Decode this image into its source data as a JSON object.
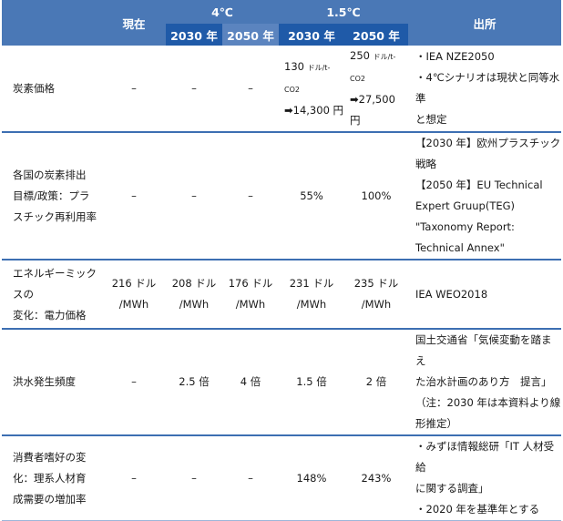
{
  "header": {
    "current": "現在",
    "group_4c": "4℃",
    "group_15c": "1.5℃",
    "source": "出所",
    "y2030": "2030 年",
    "y2050": "2050 年"
  },
  "rows": [
    {
      "label": [
        "炭素価格"
      ],
      "current": "–",
      "c4_2030": "–",
      "c4_2050": "–",
      "c15_2030": {
        "price": "130",
        "unit": "ドル/t-CO2",
        "yen": "14,300 円"
      },
      "c15_2050": {
        "price": "250",
        "unit": "ドル/t-CO2",
        "yen": "27,500 円"
      },
      "source": [
        "・IEA NZE2050",
        "・4℃シナリオは現状と同等水準",
        "と想定"
      ]
    },
    {
      "label": [
        "各国の炭素排出",
        "目標/政策：プラ",
        "スチック再利用率"
      ],
      "current": "–",
      "c4_2030": "–",
      "c4_2050": "–",
      "c15_2030": "55%",
      "c15_2050": "100%",
      "source": [
        "【2030 年】欧州プラスチック戦略",
        "【2050 年】EU Technical",
        "Expert Gruup(TEG)",
        "\"Taxonomy Report:",
        "Technical Annex\""
      ]
    },
    {
      "label": [
        "エネルギーミックスの",
        "変化：電力価格"
      ],
      "current": [
        "216 ドル",
        "/MWh"
      ],
      "c4_2030": [
        "208 ドル",
        "/MWh"
      ],
      "c4_2050": [
        "176 ドル",
        "/MWh"
      ],
      "c15_2030": [
        "231 ドル",
        "/MWh"
      ],
      "c15_2050": [
        "235 ドル",
        "/MWh"
      ],
      "source": [
        "IEA WEO2018"
      ]
    },
    {
      "label": [
        "洪水発生頻度"
      ],
      "current": "–",
      "c4_2030": "2.5 倍",
      "c4_2050": "4 倍",
      "c15_2030": "1.5 倍",
      "c15_2050": "2 倍",
      "source": [
        "国土交通省「気候変動を踏まえ",
        "た治水計画のあり方　提言」",
        "（注：2030 年は本資料より線",
        "形推定）"
      ]
    },
    {
      "label": [
        "消費者嗜好の変",
        "化：理系人材育",
        "成需要の増加率"
      ],
      "current": "–",
      "c4_2030": "–",
      "c4_2050": "–",
      "c15_2030": "148%",
      "c15_2050": "243%",
      "source": [
        "・みずほ情報総研「IT 人材受給",
        "に関する調査」",
        "・2020 年を基準年とする"
      ]
    }
  ]
}
